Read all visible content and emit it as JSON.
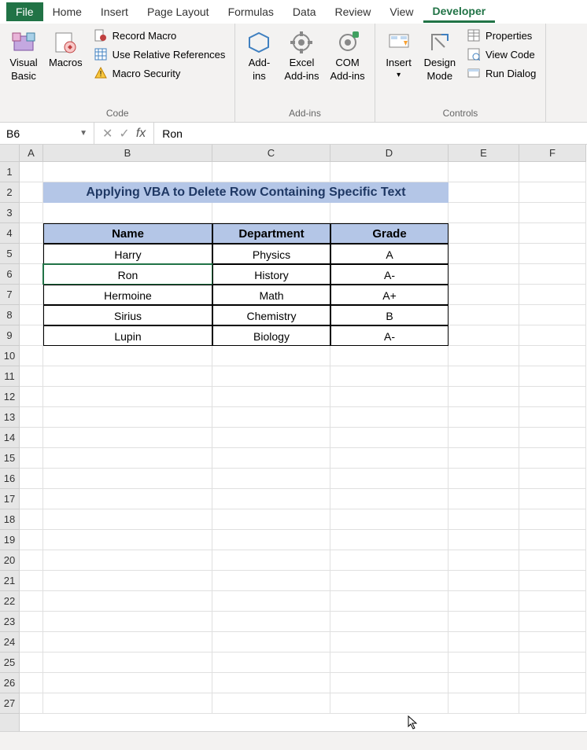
{
  "tabs": {
    "file": "File",
    "home": "Home",
    "insert": "Insert",
    "page_layout": "Page Layout",
    "formulas": "Formulas",
    "data": "Data",
    "review": "Review",
    "view": "View",
    "developer": "Developer"
  },
  "ribbon": {
    "code": {
      "visual_basic": "Visual\nBasic",
      "macros": "Macros",
      "record_macro": "Record Macro",
      "use_relative": "Use Relative References",
      "macro_security": "Macro Security",
      "label": "Code"
    },
    "addins": {
      "addins": "Add-\nins",
      "excel_addins": "Excel\nAdd-ins",
      "com_addins": "COM\nAdd-ins",
      "label": "Add-ins"
    },
    "controls": {
      "insert": "Insert",
      "design_mode": "Design\nMode",
      "properties": "Properties",
      "view_code": "View Code",
      "run_dialog": "Run Dialog",
      "label": "Controls"
    }
  },
  "name_box": "B6",
  "formula_value": "Ron",
  "col_headers": [
    "A",
    "B",
    "C",
    "D",
    "E",
    "F"
  ],
  "row_count": 27,
  "title": "Applying VBA to Delete Row Containing Specific Text",
  "table": {
    "headers": [
      "Name",
      "Department",
      "Grade"
    ],
    "rows": [
      [
        "Harry",
        "Physics",
        "A"
      ],
      [
        "Ron",
        "History",
        "A-"
      ],
      [
        "Hermoine",
        "Math",
        "A+"
      ],
      [
        "Sirius",
        "Chemistry",
        "B"
      ],
      [
        "Lupin",
        "Biology",
        "A-"
      ]
    ]
  }
}
